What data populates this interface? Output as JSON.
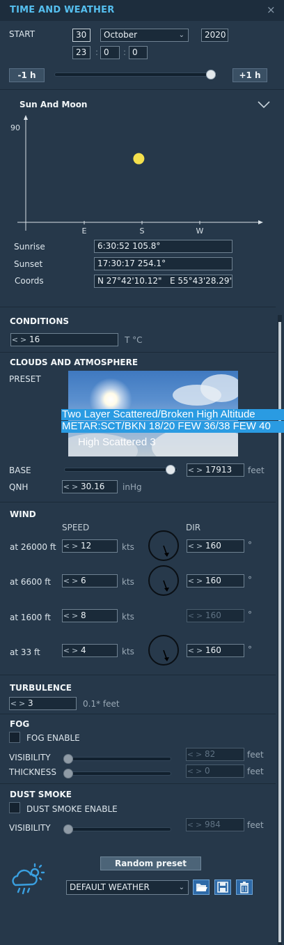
{
  "window": {
    "title": "TIME AND WEATHER",
    "close_icon": "close-icon"
  },
  "time": {
    "start_label": "START",
    "day": "30",
    "month": "October",
    "year": "2020",
    "hour": "23",
    "minute": "0",
    "second": "0",
    "minus_button": "-1 h",
    "plus_button": "+1 h",
    "slider_position": 0.99
  },
  "sun_moon": {
    "title": "Sun And Moon",
    "y_tick": "90",
    "x_ticks": [
      "E",
      "S",
      "W"
    ],
    "sun_position": {
      "azimuth": 175,
      "elevation": 60
    },
    "sunrise_label": "Sunrise",
    "sunrise": "6:30:52 105.8°",
    "sunset_label": "Sunset",
    "sunset": "17:30:17 254.1°",
    "coords_label": "Coords",
    "coords": "N 27°42'10.12\"   E 55°43'28.29\""
  },
  "conditions": {
    "title": "CONDITIONS",
    "temperature": "16",
    "temperature_unit": "T °C"
  },
  "clouds": {
    "title": "CLOUDS AND ATMOSPHERE",
    "preset_label": "PRESET",
    "preset_line1": "Two Layer Scattered/Broken High Altitude",
    "preset_line2": "METAR:SCT/BKN 18/20 FEW 36/38 FEW 40",
    "preset_name": "High Scattered 3",
    "base_label": "BASE",
    "base_value": "17913",
    "base_unit": "feet",
    "base_slider_position": 0.98,
    "qnh_label": "QNH",
    "qnh_value": "30.16",
    "qnh_unit": "inHg"
  },
  "wind": {
    "title": "WIND",
    "speed_header": "SPEED",
    "dir_header": "DIR",
    "rows": [
      {
        "label": "at 26000 ft",
        "speed": "12",
        "unit": "kts",
        "dir": "160",
        "deg": "°"
      },
      {
        "label": "at 6600 ft",
        "speed": "6",
        "unit": "kts",
        "dir": "160",
        "deg": "°"
      },
      {
        "label": "at 1600 ft",
        "speed": "8",
        "unit": "kts",
        "dir": "160",
        "deg": "°"
      },
      {
        "label": "at 33 ft",
        "speed": "4",
        "unit": "kts",
        "dir": "160",
        "deg": "°"
      }
    ]
  },
  "turbulence": {
    "title": "TURBULENCE",
    "value": "3",
    "unit": "0.1* feet"
  },
  "fog": {
    "title": "FOG",
    "enable_label": "FOG ENABLE",
    "visibility_label": "VISIBILITY",
    "visibility_value": "82",
    "thickness_label": "THICKNESS",
    "thickness_value": "0",
    "unit": "feet"
  },
  "dust": {
    "title": "DUST SMOKE",
    "enable_label": "DUST SMOKE ENABLE",
    "visibility_label": "VISIBILITY",
    "visibility_value": "984",
    "unit": "feet"
  },
  "footer": {
    "random_button": "Random preset",
    "preset_select": "DEFAULT WEATHER",
    "icons": [
      "weather-icon",
      "open-folder-icon",
      "save-icon",
      "trash-icon"
    ]
  },
  "colors": {
    "accent": "#55bfef",
    "selection": "#2a9be2",
    "sun": "#f4e04d",
    "button": "#2e6aa8"
  }
}
